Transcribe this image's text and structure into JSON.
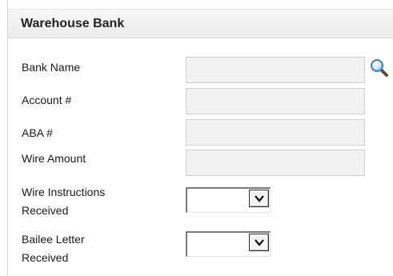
{
  "panel": {
    "title": "Warehouse Bank"
  },
  "fields": {
    "bank_name": {
      "label": "Bank Name",
      "value": ""
    },
    "account": {
      "label": "Account #",
      "value": ""
    },
    "aba": {
      "label": "ABA #",
      "value": ""
    },
    "wire_amount": {
      "label": "Wire Amount",
      "value": ""
    },
    "wire_instructions_received": {
      "label_line1": "Wire Instructions",
      "label_line2": "Received",
      "selected": ""
    },
    "bailee_letter_received": {
      "label_line1": "Bailee Letter",
      "label_line2": "Received",
      "selected": ""
    }
  },
  "icons": {
    "lookup": "magnifier-icon",
    "dropdown": "chevron-down-icon"
  },
  "colors": {
    "header_bg": "#ececec",
    "field_bg": "#f2f2f2",
    "search_icon": "#3b7fc4"
  }
}
